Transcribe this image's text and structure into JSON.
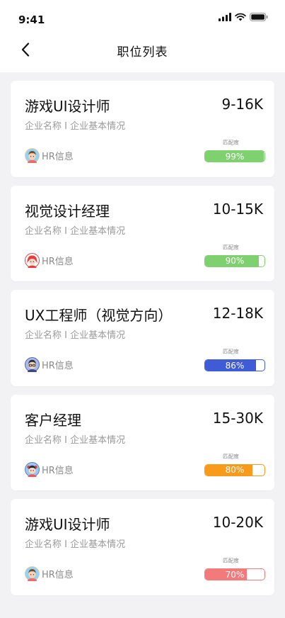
{
  "status_bar": {
    "time": "9:41"
  },
  "nav": {
    "title": "职位列表"
  },
  "jobs": [
    {
      "title": "游戏UI设计师",
      "salary": "9-16K",
      "company": "企业名称 I 企业基本情况",
      "hr_label": "HR信息",
      "match_label": "匹配度",
      "match_text": "99%",
      "match": 0.99,
      "color": "#7fd06f"
    },
    {
      "title": "视觉设计经理",
      "salary": "10-15K",
      "company": "企业名称 I 企业基本情况",
      "hr_label": "HR信息",
      "match_label": "匹配度",
      "match_text": "90%",
      "match": 0.9,
      "color": "#7fd06f"
    },
    {
      "title": "UX工程师（视觉方向）",
      "salary": "12-18K",
      "company": "企业名称 I 企业基本情况",
      "hr_label": "HR信息",
      "match_label": "匹配度",
      "match_text": "86%",
      "match": 0.86,
      "color": "#3f5bd5"
    },
    {
      "title": "客户经理",
      "salary": "15-30K",
      "company": "企业名称 I 企业基本情况",
      "hr_label": "HR信息",
      "match_label": "匹配度",
      "match_text": "80%",
      "match": 0.8,
      "color": "#f99a1b"
    },
    {
      "title": "游戏UI设计师",
      "salary": "10-20K",
      "company": "企业名称 I 企业基本情况",
      "hr_label": "HR信息",
      "match_label": "匹配度",
      "match_text": "70%",
      "match": 0.7,
      "color": "#f27a7a"
    }
  ]
}
